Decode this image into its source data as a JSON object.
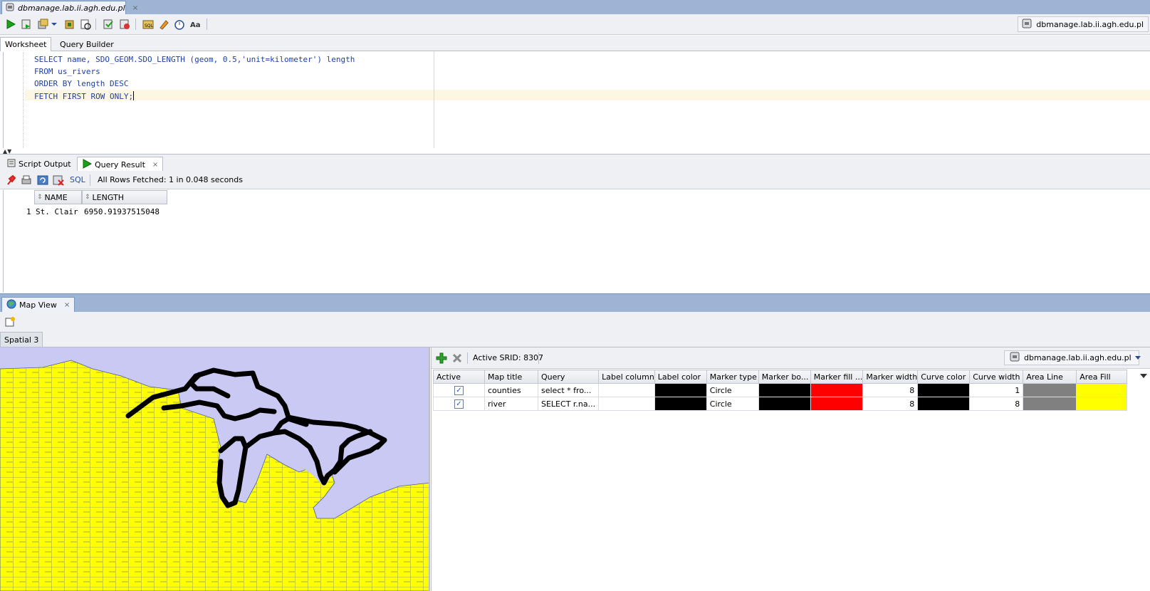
{
  "connection_tab": {
    "title": "dbmanage.lab.ii.agh.edu.pl",
    "close": "×"
  },
  "toolbar": {
    "connection": "dbmanage.lab.ii.agh.edu.pl",
    "icons": [
      "run-statement-icon",
      "run-script-icon",
      "commit-icon",
      "dropdown-arrow-icon",
      "rollback-icon",
      "tuning-icon",
      "explain-plan-icon",
      "autotrace-icon",
      "sql-history-icon",
      "clear-icon",
      "format-icon",
      "timer-icon",
      "uppercase-icon"
    ]
  },
  "worksheet_tabs": {
    "worksheet": "Worksheet",
    "query_builder": "Query Builder"
  },
  "editor": {
    "lines": [
      "SELECT name, SDO_GEOM.SDO_LENGTH (geom, 0.5,'unit=kilometer') length",
      "FROM us_rivers",
      "ORDER BY length DESC",
      "FETCH FIRST ROW ONLY;"
    ]
  },
  "result_tabs": {
    "script_output": "Script Output",
    "query_result": "Query Result",
    "close": "×"
  },
  "result_toolbar": {
    "sql_label": "SQL",
    "status": "All Rows Fetched: 1 in 0.048 seconds"
  },
  "result_grid": {
    "columns": [
      "NAME",
      "LENGTH"
    ],
    "rows": [
      {
        "num": "1",
        "name": "St. Clair",
        "length": "6950.91937515048"
      }
    ]
  },
  "map_view": {
    "tab": "Map View",
    "close": "×",
    "spatial_tab": "Spatial 3",
    "srid_label": "Active SRID: 8307",
    "connection": "dbmanage.lab.ii.agh.edu.pl",
    "colors": {
      "land": "#ffff00",
      "water": "#c9c9f4",
      "river": "#000000"
    }
  },
  "layers": {
    "columns": [
      "Active",
      "Map title",
      "Query",
      "Label column",
      "Label color",
      "Marker type",
      "Marker bo...",
      "Marker fill ...",
      "Marker width",
      "Curve color",
      "Curve width",
      "Area Line",
      "Area Fill"
    ],
    "rows": [
      {
        "active": true,
        "title": "counties",
        "query": "select * fro...",
        "label_column": "",
        "label_color": "#000000",
        "marker_type": "Circle",
        "marker_border": "#000000",
        "marker_fill": "#ff0000",
        "marker_width": "8",
        "curve_color": "#000000",
        "curve_width": "1",
        "area_line": "#808080",
        "area_fill": "#ffff00"
      },
      {
        "active": true,
        "title": "river",
        "query": "SELECT r.na...",
        "label_column": "",
        "label_color": "#000000",
        "marker_type": "Circle",
        "marker_border": "#000000",
        "marker_fill": "#ff0000",
        "marker_width": "8",
        "curve_color": "#000000",
        "curve_width": "8",
        "area_line": "#808080",
        "area_fill": "#ffff00"
      }
    ]
  }
}
